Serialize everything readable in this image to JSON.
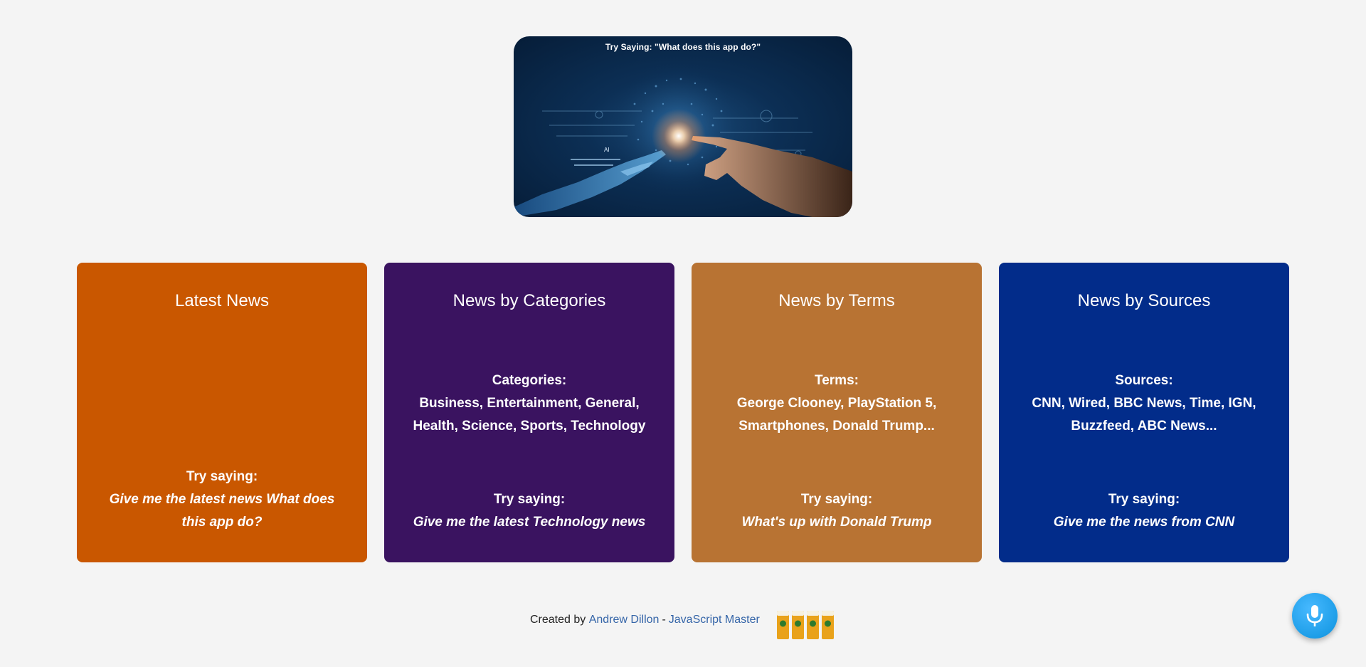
{
  "hero": {
    "caption": "Try Saying: \"What does this app do?\""
  },
  "cards": [
    {
      "title": "Latest News",
      "body_heading": "",
      "body_text": "",
      "try_label": "Try saying:",
      "try_example": "Give me the latest news What does this app do?",
      "color": "#c95700"
    },
    {
      "title": "News by Categories",
      "body_heading": "Categories:",
      "body_text": "Business, Entertainment, General, Health, Science, Sports, Technology",
      "try_label": "Try saying:",
      "try_example": "Give me the latest Technology news",
      "color": "#3a1360"
    },
    {
      "title": "News by Terms",
      "body_heading": "Terms:",
      "body_text": "George Clooney, PlayStation 5, Smartphones, Donald Trump...",
      "try_label": "Try saying:",
      "try_example": "What's up with Donald Trump",
      "color": "#b87333"
    },
    {
      "title": "News by Sources",
      "body_heading": "Sources:",
      "body_text": "CNN, Wired, BBC News, Time, IGN, Buzzfeed, ABC News...",
      "try_label": "Try saying:",
      "try_example": "Give me the news from CNN",
      "color": "#022c8a"
    }
  ],
  "footer": {
    "prefix": "Created by",
    "author": "Andrew Dillon",
    "separator": "-",
    "author_title": "JavaScript Master"
  },
  "icons": {
    "mic": "microphone-icon",
    "beers": "beer-glasses-icon"
  }
}
